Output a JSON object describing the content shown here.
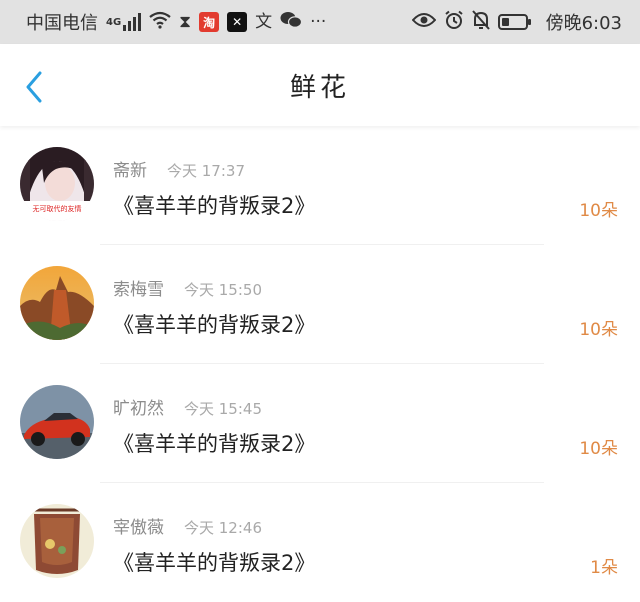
{
  "status_bar": {
    "carrier": "中国电信",
    "network": "4G",
    "app_badges": [
      "淘",
      "✕"
    ],
    "time": "傍晚6:03",
    "battery_level": 0.35
  },
  "header": {
    "title": "鲜花"
  },
  "items": [
    {
      "name": "斋新",
      "time": "今天 17:37",
      "book": "《喜羊羊的背叛录2》",
      "count": "10朵",
      "avatar_caption": "无可取代的友情"
    },
    {
      "name": "索梅雪",
      "time": "今天 15:50",
      "book": "《喜羊羊的背叛录2》",
      "count": "10朵"
    },
    {
      "name": "旷初然",
      "time": "今天 15:45",
      "book": "《喜羊羊的背叛录2》",
      "count": "10朵"
    },
    {
      "name": "宰傲薇",
      "time": "今天 12:46",
      "book": "《喜羊羊的背叛录2》",
      "count": "1朵"
    }
  ],
  "colors": {
    "accent": "#2a9fe0",
    "count": "#e08a46"
  }
}
